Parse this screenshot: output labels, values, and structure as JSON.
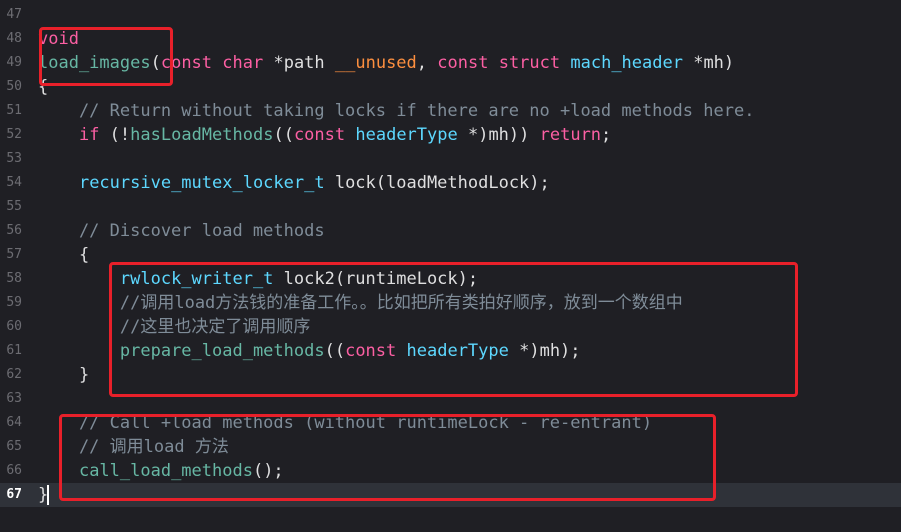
{
  "editor": {
    "current_line": "67",
    "lines": [
      {
        "n": "47",
        "tokens": []
      },
      {
        "n": "48",
        "tokens": [
          {
            "t": "void",
            "c": "kw"
          }
        ]
      },
      {
        "n": "49",
        "tokens": [
          {
            "t": "load_images",
            "c": "fn"
          },
          {
            "t": "(",
            "c": "pl"
          },
          {
            "t": "const",
            "c": "kw"
          },
          {
            "t": " ",
            "c": "pl"
          },
          {
            "t": "char",
            "c": "kw"
          },
          {
            "t": " *path ",
            "c": "pl"
          },
          {
            "t": "__unused",
            "c": "pre"
          },
          {
            "t": ", ",
            "c": "pl"
          },
          {
            "t": "const",
            "c": "kw"
          },
          {
            "t": " ",
            "c": "pl"
          },
          {
            "t": "struct",
            "c": "kw"
          },
          {
            "t": " ",
            "c": "pl"
          },
          {
            "t": "mach_header",
            "c": "ty"
          },
          {
            "t": " *mh)",
            "c": "pl"
          }
        ]
      },
      {
        "n": "50",
        "tokens": [
          {
            "t": "{",
            "c": "pl"
          }
        ]
      },
      {
        "n": "51",
        "tokens": [
          {
            "t": "    // Return without taking locks if there are no +load methods here.",
            "c": "cm"
          }
        ]
      },
      {
        "n": "52",
        "tokens": [
          {
            "t": "    ",
            "c": "pl"
          },
          {
            "t": "if",
            "c": "kw"
          },
          {
            "t": " (!",
            "c": "pl"
          },
          {
            "t": "hasLoadMethods",
            "c": "fn"
          },
          {
            "t": "((",
            "c": "pl"
          },
          {
            "t": "const",
            "c": "kw"
          },
          {
            "t": " ",
            "c": "pl"
          },
          {
            "t": "headerType",
            "c": "ty"
          },
          {
            "t": " *)mh)) ",
            "c": "pl"
          },
          {
            "t": "return",
            "c": "kw"
          },
          {
            "t": ";",
            "c": "pl"
          }
        ]
      },
      {
        "n": "53",
        "tokens": []
      },
      {
        "n": "54",
        "tokens": [
          {
            "t": "    ",
            "c": "pl"
          },
          {
            "t": "recursive_mutex_locker_t",
            "c": "ty"
          },
          {
            "t": " lock(loadMethodLock);",
            "c": "pl"
          }
        ]
      },
      {
        "n": "55",
        "tokens": []
      },
      {
        "n": "56",
        "tokens": [
          {
            "t": "    // Discover load methods",
            "c": "cm"
          }
        ]
      },
      {
        "n": "57",
        "tokens": [
          {
            "t": "    {",
            "c": "pl"
          }
        ]
      },
      {
        "n": "58",
        "tokens": [
          {
            "t": "        ",
            "c": "pl"
          },
          {
            "t": "rwlock_writer_t",
            "c": "ty"
          },
          {
            "t": " lock2(runtimeLock);",
            "c": "pl"
          }
        ]
      },
      {
        "n": "59",
        "tokens": [
          {
            "t": "        //调用load方法钱的准备工作。。比如把所有类拍好顺序，放到一个数组中",
            "c": "cm"
          }
        ]
      },
      {
        "n": "60",
        "tokens": [
          {
            "t": "        //这里也决定了调用顺序",
            "c": "cm"
          }
        ]
      },
      {
        "n": "61",
        "tokens": [
          {
            "t": "        ",
            "c": "pl"
          },
          {
            "t": "prepare_load_methods",
            "c": "fn"
          },
          {
            "t": "((",
            "c": "pl"
          },
          {
            "t": "const",
            "c": "kw"
          },
          {
            "t": " ",
            "c": "pl"
          },
          {
            "t": "headerType",
            "c": "ty"
          },
          {
            "t": " *)mh);",
            "c": "pl"
          }
        ]
      },
      {
        "n": "62",
        "tokens": [
          {
            "t": "    }",
            "c": "pl"
          }
        ]
      },
      {
        "n": "63",
        "tokens": []
      },
      {
        "n": "64",
        "tokens": [
          {
            "t": "    // Call +load methods (without runtimeLock - re-entrant)",
            "c": "cm"
          }
        ]
      },
      {
        "n": "65",
        "tokens": [
          {
            "t": "    // 调用load 方法",
            "c": "cm"
          }
        ]
      },
      {
        "n": "66",
        "tokens": [
          {
            "t": "    ",
            "c": "pl"
          },
          {
            "t": "call_load_methods",
            "c": "fn"
          },
          {
            "t": "();",
            "c": "pl"
          }
        ]
      },
      {
        "n": "67",
        "tokens": [
          {
            "t": "}",
            "c": "pl"
          }
        ]
      }
    ]
  },
  "colors": {
    "background": "#1f1f24",
    "keyword": "#fc5fa3",
    "function": "#67b7a4",
    "type": "#5dd8ff",
    "attribute": "#fd8f3f",
    "comment": "#7f8c98",
    "plain": "#dfdfe0",
    "annotation_box": "#e8202a"
  }
}
